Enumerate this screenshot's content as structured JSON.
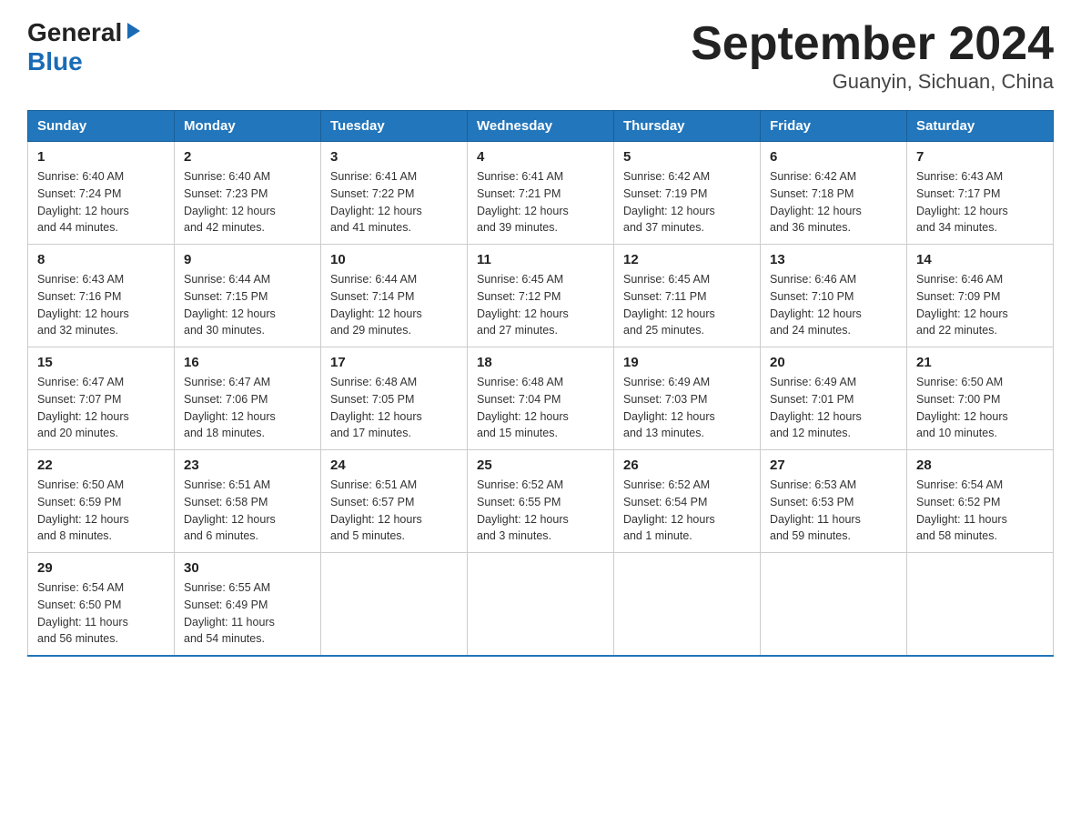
{
  "logo": {
    "general": "General",
    "blue": "Blue",
    "arrow": "▶"
  },
  "title": "September 2024",
  "subtitle": "Guanyin, Sichuan, China",
  "days_of_week": [
    "Sunday",
    "Monday",
    "Tuesday",
    "Wednesday",
    "Thursday",
    "Friday",
    "Saturday"
  ],
  "weeks": [
    [
      {
        "day": "1",
        "sunrise": "6:40 AM",
        "sunset": "7:24 PM",
        "daylight": "12 hours and 44 minutes."
      },
      {
        "day": "2",
        "sunrise": "6:40 AM",
        "sunset": "7:23 PM",
        "daylight": "12 hours and 42 minutes."
      },
      {
        "day": "3",
        "sunrise": "6:41 AM",
        "sunset": "7:22 PM",
        "daylight": "12 hours and 41 minutes."
      },
      {
        "day": "4",
        "sunrise": "6:41 AM",
        "sunset": "7:21 PM",
        "daylight": "12 hours and 39 minutes."
      },
      {
        "day": "5",
        "sunrise": "6:42 AM",
        "sunset": "7:19 PM",
        "daylight": "12 hours and 37 minutes."
      },
      {
        "day": "6",
        "sunrise": "6:42 AM",
        "sunset": "7:18 PM",
        "daylight": "12 hours and 36 minutes."
      },
      {
        "day": "7",
        "sunrise": "6:43 AM",
        "sunset": "7:17 PM",
        "daylight": "12 hours and 34 minutes."
      }
    ],
    [
      {
        "day": "8",
        "sunrise": "6:43 AM",
        "sunset": "7:16 PM",
        "daylight": "12 hours and 32 minutes."
      },
      {
        "day": "9",
        "sunrise": "6:44 AM",
        "sunset": "7:15 PM",
        "daylight": "12 hours and 30 minutes."
      },
      {
        "day": "10",
        "sunrise": "6:44 AM",
        "sunset": "7:14 PM",
        "daylight": "12 hours and 29 minutes."
      },
      {
        "day": "11",
        "sunrise": "6:45 AM",
        "sunset": "7:12 PM",
        "daylight": "12 hours and 27 minutes."
      },
      {
        "day": "12",
        "sunrise": "6:45 AM",
        "sunset": "7:11 PM",
        "daylight": "12 hours and 25 minutes."
      },
      {
        "day": "13",
        "sunrise": "6:46 AM",
        "sunset": "7:10 PM",
        "daylight": "12 hours and 24 minutes."
      },
      {
        "day": "14",
        "sunrise": "6:46 AM",
        "sunset": "7:09 PM",
        "daylight": "12 hours and 22 minutes."
      }
    ],
    [
      {
        "day": "15",
        "sunrise": "6:47 AM",
        "sunset": "7:07 PM",
        "daylight": "12 hours and 20 minutes."
      },
      {
        "day": "16",
        "sunrise": "6:47 AM",
        "sunset": "7:06 PM",
        "daylight": "12 hours and 18 minutes."
      },
      {
        "day": "17",
        "sunrise": "6:48 AM",
        "sunset": "7:05 PM",
        "daylight": "12 hours and 17 minutes."
      },
      {
        "day": "18",
        "sunrise": "6:48 AM",
        "sunset": "7:04 PM",
        "daylight": "12 hours and 15 minutes."
      },
      {
        "day": "19",
        "sunrise": "6:49 AM",
        "sunset": "7:03 PM",
        "daylight": "12 hours and 13 minutes."
      },
      {
        "day": "20",
        "sunrise": "6:49 AM",
        "sunset": "7:01 PM",
        "daylight": "12 hours and 12 minutes."
      },
      {
        "day": "21",
        "sunrise": "6:50 AM",
        "sunset": "7:00 PM",
        "daylight": "12 hours and 10 minutes."
      }
    ],
    [
      {
        "day": "22",
        "sunrise": "6:50 AM",
        "sunset": "6:59 PM",
        "daylight": "12 hours and 8 minutes."
      },
      {
        "day": "23",
        "sunrise": "6:51 AM",
        "sunset": "6:58 PM",
        "daylight": "12 hours and 6 minutes."
      },
      {
        "day": "24",
        "sunrise": "6:51 AM",
        "sunset": "6:57 PM",
        "daylight": "12 hours and 5 minutes."
      },
      {
        "day": "25",
        "sunrise": "6:52 AM",
        "sunset": "6:55 PM",
        "daylight": "12 hours and 3 minutes."
      },
      {
        "day": "26",
        "sunrise": "6:52 AM",
        "sunset": "6:54 PM",
        "daylight": "12 hours and 1 minute."
      },
      {
        "day": "27",
        "sunrise": "6:53 AM",
        "sunset": "6:53 PM",
        "daylight": "11 hours and 59 minutes."
      },
      {
        "day": "28",
        "sunrise": "6:54 AM",
        "sunset": "6:52 PM",
        "daylight": "11 hours and 58 minutes."
      }
    ],
    [
      {
        "day": "29",
        "sunrise": "6:54 AM",
        "sunset": "6:50 PM",
        "daylight": "11 hours and 56 minutes."
      },
      {
        "day": "30",
        "sunrise": "6:55 AM",
        "sunset": "6:49 PM",
        "daylight": "11 hours and 54 minutes."
      },
      {
        "day": "",
        "sunrise": "",
        "sunset": "",
        "daylight": ""
      },
      {
        "day": "",
        "sunrise": "",
        "sunset": "",
        "daylight": ""
      },
      {
        "day": "",
        "sunrise": "",
        "sunset": "",
        "daylight": ""
      },
      {
        "day": "",
        "sunrise": "",
        "sunset": "",
        "daylight": ""
      },
      {
        "day": "",
        "sunrise": "",
        "sunset": "",
        "daylight": ""
      }
    ]
  ],
  "sunrise_label": "Sunrise:",
  "sunset_label": "Sunset:",
  "daylight_label": "Daylight:"
}
